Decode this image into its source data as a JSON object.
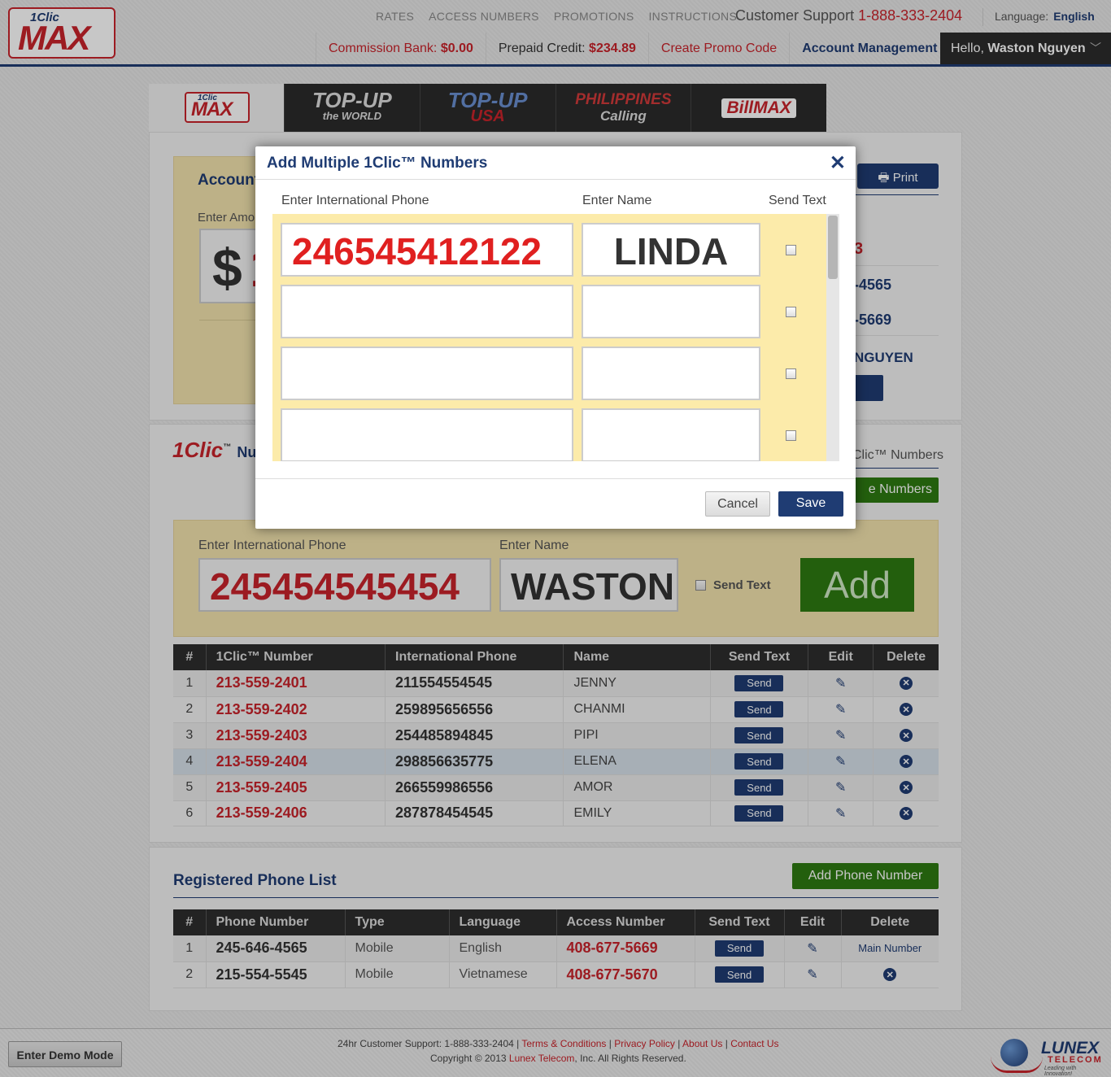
{
  "header": {
    "logo_small": "1Clic",
    "logo_big": "MAX",
    "nav": [
      "RATES",
      "ACCESS NUMBERS",
      "PROMOTIONS",
      "INSTRUCTIONS"
    ],
    "support_label": "Customer Support",
    "support_phone": "1-888-333-2404",
    "language_label": "Language:",
    "language_value": "English",
    "commission_label": "Commission Bank:",
    "commission_value": "$0.00",
    "prepaid_label": "Prepaid Credit:",
    "prepaid_value": "$234.89",
    "create_promo": "Create Promo Code",
    "account_mgmt": "Account Management",
    "hello_prefix": "Hello,",
    "hello_name": "Waston Nguyen"
  },
  "brands": {
    "logo_small": "1Clic",
    "logo_big": "MAX",
    "items": [
      "TOP-UP WORLD",
      "TOP-UP USA",
      "PHILIPPINES Calling",
      "BillMAX"
    ],
    "item_lines": [
      [
        "TOP-UP",
        "the WORLD"
      ],
      [
        "TOP-UP",
        "USA"
      ],
      [
        "PHILIPPINES",
        "Calling"
      ],
      [
        "BillMAX",
        ""
      ]
    ]
  },
  "account": {
    "title": "Account I",
    "enter_amount_label": "Enter Amo",
    "amount_prefix": "$",
    "amount_value": "1",
    "print": "Print",
    "r1": "3",
    "r2": "-4565",
    "r3": "-5669",
    "r4": "NGUYEN"
  },
  "numbers": {
    "title_brand": "1Clic",
    "title_rest": "Nu",
    "right_label": "Clic™ Numbers",
    "right_button": "e Numbers",
    "phone_label": "Enter International Phone",
    "name_label": "Enter Name",
    "phone_value": "245454545454",
    "name_value": "WASTON",
    "send_text_label": "Send Text",
    "add_button": "Add",
    "columns": [
      "#",
      "1Clic™ Number",
      "International Phone",
      "Name",
      "Send Text",
      "Edit",
      "Delete"
    ],
    "send_label": "Send",
    "rows": [
      {
        "n": "1",
        "clic": "213-559-2401",
        "intl": "211554554545",
        "name": "JENNY"
      },
      {
        "n": "2",
        "clic": "213-559-2402",
        "intl": "259895656556",
        "name": "CHANMI"
      },
      {
        "n": "3",
        "clic": "213-559-2403",
        "intl": "254485894845",
        "name": "PIPI"
      },
      {
        "n": "4",
        "clic": "213-559-2404",
        "intl": "298856635775",
        "name": "ELENA"
      },
      {
        "n": "5",
        "clic": "213-559-2405",
        "intl": "266559986556",
        "name": "AMOR"
      },
      {
        "n": "6",
        "clic": "213-559-2406",
        "intl": "287878454545",
        "name": "EMILY"
      }
    ]
  },
  "registered": {
    "title": "Registered Phone List",
    "add_button": "Add Phone Number",
    "columns": [
      "#",
      "Phone Number",
      "Type",
      "Language",
      "Access Number",
      "Send Text",
      "Edit",
      "Delete"
    ],
    "send_label": "Send",
    "rows": [
      {
        "n": "1",
        "phone": "245-646-4565",
        "type": "Mobile",
        "language": "English",
        "access": "408-677-5669",
        "delete": "Main Number"
      },
      {
        "n": "2",
        "phone": "215-554-5545",
        "type": "Mobile",
        "language": "Vietnamese",
        "access": "408-677-5670",
        "delete": ""
      }
    ]
  },
  "modal": {
    "title": "Add Multiple 1Clic™ Numbers",
    "col_phone": "Enter International Phone",
    "col_name": "Enter Name",
    "col_send": "Send Text",
    "rows": [
      {
        "phone": "246545412122",
        "name": "LINDA"
      },
      {
        "phone": "",
        "name": ""
      },
      {
        "phone": "",
        "name": ""
      },
      {
        "phone": "",
        "name": ""
      }
    ],
    "cancel": "Cancel",
    "save": "Save"
  },
  "footer": {
    "demo_button": "Enter Demo Mode",
    "support": "24hr Customer Support: 1-888-333-2404 |",
    "links": [
      "Terms & Conditions",
      "Privacy Policy",
      "About Us",
      "Contact Us"
    ],
    "copyright_pre": "Copyright © 2013",
    "copyright_company": "Lunex Telecom",
    "copyright_post": ", Inc. All Rights Reserved.",
    "logo_text": "LUNEX",
    "logo_sub": "TELECOM",
    "logo_tag": "Leading with Innovation!"
  }
}
